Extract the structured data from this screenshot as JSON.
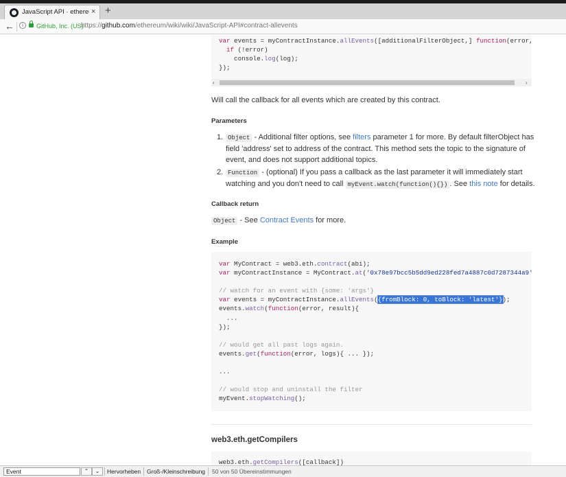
{
  "browser": {
    "tab_title": "JavaScript API · ethereum/...",
    "tab_close": "×",
    "new_tab": "+",
    "back": "←",
    "info": "i",
    "identity": "GitHub, Inc. (US)",
    "url_scheme": "https://",
    "url_host": "github.com",
    "url_path": "/ethereum/wiki/wiki/JavaScript-API#contract-allevents"
  },
  "code_top": [
    [
      {
        "t": "var",
        "c": "k"
      },
      {
        "t": " events = myContractInstance."
      },
      {
        "t": "allEvents",
        "c": "f"
      },
      {
        "t": "([additionalFilterObject,] "
      },
      {
        "t": "function",
        "c": "k"
      },
      {
        "t": "(error, log"
      }
    ],
    [
      {
        "t": "  "
      },
      {
        "t": "if",
        "c": "k"
      },
      {
        "t": " (!error)"
      }
    ],
    [
      {
        "t": "    console."
      },
      {
        "t": "log",
        "c": "f"
      },
      {
        "t": "(log);"
      }
    ],
    [
      {
        "t": "});"
      }
    ]
  ],
  "scrollbar": {
    "left_arrow": "‹",
    "right_arrow": "›"
  },
  "intro_text": "Will call the callback for all events which are created by this contract.",
  "parameters": {
    "heading": "Parameters",
    "items": [
      {
        "num": "1.",
        "code": "Object",
        "line1_a": " - Additional filter options, see ",
        "line1_link": "filters",
        "line1_b": " parameter 1 for more. By default filterObject has",
        "line2": "field 'address' set to address of the contract. This method sets the topic to the signature of",
        "line3": "event, and does not support additional topics."
      },
      {
        "num": "2.",
        "code": "Function",
        "line1": " - (optional) If you pass a callback as the last parameter it will immediately start",
        "line2_a": "watching and you don't need to call ",
        "line2_code": "myEvent.watch(function(){})",
        "line2_b": ". See ",
        "line2_link": "this note",
        "line2_c": " for details."
      }
    ]
  },
  "callback_return": {
    "heading": "Callback return",
    "code": "Object",
    "text_a": " - See ",
    "link": "Contract Events",
    "text_b": " for more."
  },
  "example": {
    "heading": "Example",
    "lines": [
      [
        {
          "t": "var",
          "c": "k"
        },
        {
          "t": " MyContract = web3.eth."
        },
        {
          "t": "contract",
          "c": "f"
        },
        {
          "t": "(abi);"
        }
      ],
      [
        {
          "t": "var",
          "c": "k"
        },
        {
          "t": " myContractInstance = MyContract."
        },
        {
          "t": "at",
          "c": "f"
        },
        {
          "t": "("
        },
        {
          "t": "'0x78e97bcc5b5dd9ed228fed7a4887c0d7287344a9'",
          "c": "s"
        },
        {
          "t": ");"
        }
      ],
      [],
      [
        {
          "t": "// watch for an event with {some: 'args'}",
          "c": "c"
        }
      ],
      [
        {
          "t": "var",
          "c": "k"
        },
        {
          "t": " events = myContractInstance."
        },
        {
          "t": "allEvents",
          "c": "f"
        },
        {
          "t": "("
        },
        {
          "t": "{fromBlock: 0, toBlock: 'latest'}",
          "c": "hl"
        },
        {
          "t": ");"
        }
      ],
      [
        {
          "t": "events."
        },
        {
          "t": "watch",
          "c": "f"
        },
        {
          "t": "("
        },
        {
          "t": "function",
          "c": "k"
        },
        {
          "t": "(error, result){"
        }
      ],
      [
        {
          "t": "  ..."
        }
      ],
      [
        {
          "t": "});"
        }
      ],
      [],
      [
        {
          "t": "// would get all past logs again.",
          "c": "c"
        }
      ],
      [
        {
          "t": "events."
        },
        {
          "t": "get",
          "c": "f"
        },
        {
          "t": "("
        },
        {
          "t": "function",
          "c": "k"
        },
        {
          "t": "(error, logs){ ... });"
        }
      ],
      [],
      [
        {
          "t": "..."
        }
      ],
      [],
      [
        {
          "t": "// would stop and uninstall the filter",
          "c": "c"
        }
      ],
      [
        {
          "t": "myEvent."
        },
        {
          "t": "stopWatching",
          "c": "f"
        },
        {
          "t": "();"
        }
      ]
    ]
  },
  "next_section": {
    "heading": "web3.eth.getCompilers",
    "code_line": [
      {
        "t": "web3.eth."
      },
      {
        "t": "getCompilers",
        "c": "f"
      },
      {
        "t": "([callback])"
      }
    ]
  },
  "findbar": {
    "input_value": "Event",
    "prev": "⌃",
    "next": "⌄",
    "highlight_label": "Hervorheben",
    "case_label": "Groß-/Kleinschreibung",
    "status": "50 von 50 Übereinstimmungen"
  }
}
